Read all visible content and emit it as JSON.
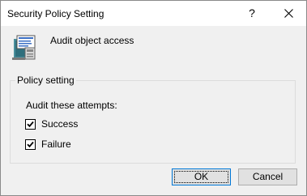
{
  "window": {
    "title": "Security Policy Setting",
    "help_glyph": "?",
    "close_icon": "close-icon"
  },
  "policy": {
    "icon": "security-policy-icon",
    "name": "Audit object access"
  },
  "group": {
    "legend": "Policy setting",
    "attempts_label": "Audit these attempts:",
    "options": [
      {
        "label": "Success",
        "checked": true
      },
      {
        "label": "Failure",
        "checked": true
      }
    ]
  },
  "buttons": {
    "ok_label": "OK",
    "cancel_label": "Cancel"
  },
  "colors": {
    "titlebar": "#ffffff",
    "dialog_bg": "#f0f0f0",
    "default_button_border": "#0078d7"
  }
}
